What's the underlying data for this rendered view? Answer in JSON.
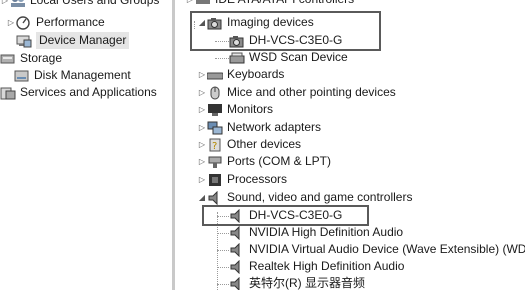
{
  "left_tree": {
    "items": [
      {
        "label": "Local Users and Groups",
        "icon": "users-icon"
      },
      {
        "label": "Performance",
        "icon": "performance-icon"
      },
      {
        "label": "Device Manager",
        "icon": "device-manager-icon"
      },
      {
        "label": "Storage",
        "icon": "storage-icon"
      },
      {
        "label": "Disk Management",
        "icon": "disk-icon"
      },
      {
        "label": "Services and Applications",
        "icon": "services-icon"
      }
    ]
  },
  "right_tree": {
    "top_clipped": "IDE ATA/ATAPI controllers",
    "imaging": {
      "label": "Imaging devices",
      "children": [
        "DH-VCS-C3E0-G",
        "WSD Scan Device"
      ]
    },
    "categories": [
      "Keyboards",
      "Mice and other pointing devices",
      "Monitors",
      "Network adapters",
      "Other devices",
      "Ports (COM & LPT)",
      "Processors"
    ],
    "sound": {
      "label": "Sound, video and game controllers",
      "children": [
        "DH-VCS-C3E0-G",
        "NVIDIA High Definition Audio",
        "NVIDIA Virtual Audio Device (Wave Extensible) (WDM)",
        "Realtek High Definition Audio",
        "英特尔(R) 显示器音频"
      ]
    }
  }
}
